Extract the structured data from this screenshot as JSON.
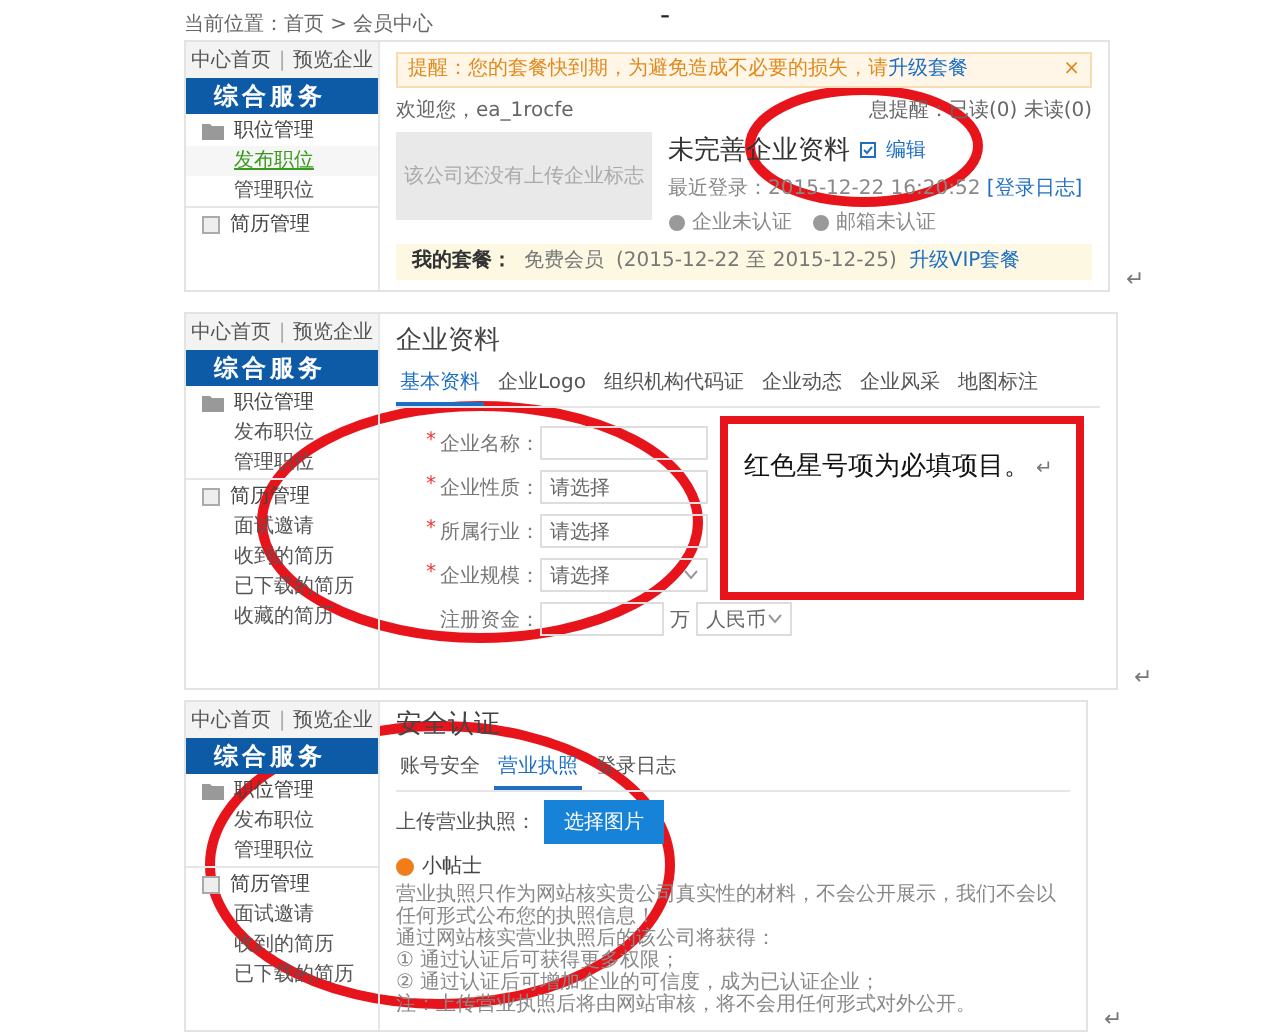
{
  "page_mark": "-",
  "member_center": {
    "breadcrumb": "当前位置：首页 > 会员中心",
    "sidebar": {
      "links": [
        "中心首页",
        "预览企业"
      ],
      "link_separator": "|",
      "header": "综合服务",
      "groups": [
        {
          "title": "职位管理",
          "items": [
            {
              "label": "发布职位",
              "selected": true
            },
            {
              "label": "管理职位",
              "selected": false
            }
          ]
        },
        {
          "title": "简历管理"
        }
      ]
    },
    "notice": {
      "text": "提醒：您的套餐快到期，为避免造成不必要的损失，请",
      "link": "升级套餐",
      "close": "×"
    },
    "welcome": "欢迎您，ea_1rocfe",
    "message_status": "息提醒：已读(0) 未读(0)",
    "logo_placeholder": "该公司还没有上传企业标志",
    "profile_status": "未完善企业资料",
    "edit_link": "编辑",
    "last_login": "最近登录：2015-12-22 16:20:52",
    "login_log_link": "[登录日志]",
    "badges": [
      "企业未认证",
      "邮箱未认证"
    ],
    "plan": {
      "label": "我的套餐：",
      "value": "免费会员",
      "period": "(2015-12-22 至 2015-12-25)",
      "upgrade_link": "升级VIP套餐"
    },
    "paragraph_mark": "↵"
  },
  "company_profile": {
    "sidebar": {
      "links": [
        "中心首页",
        "预览企业"
      ],
      "link_separator": "|",
      "header": "综合服务",
      "groups": [
        {
          "title": "职位管理",
          "items": [
            {
              "label": "发布职位",
              "selected": false
            },
            {
              "label": "管理职位",
              "selected": false
            }
          ]
        },
        {
          "title": "简历管理",
          "items": [
            {
              "label": "面试邀请",
              "selected": false
            },
            {
              "label": "收到的简历",
              "selected": false
            },
            {
              "label": "已下载的简历",
              "selected": false
            },
            {
              "label": "收藏的简历",
              "selected": false
            }
          ]
        }
      ]
    },
    "title": "企业资料",
    "tabs": [
      {
        "label": "基本资料",
        "selected": true
      },
      {
        "label": "企业Logo",
        "selected": false
      },
      {
        "label": "组织机构代码证",
        "selected": false
      },
      {
        "label": "企业动态",
        "selected": false
      },
      {
        "label": "企业风采",
        "selected": false
      },
      {
        "label": "地图标注",
        "selected": false
      }
    ],
    "fields": [
      {
        "kind": "text",
        "required_mark": "*",
        "label": "企业名称："
      },
      {
        "kind": "select_plain",
        "required_mark": "*",
        "label": "企业性质：",
        "placeholder": "请选择"
      },
      {
        "kind": "select_plain",
        "required_mark": "*",
        "label": "所属行业：",
        "placeholder": "请选择"
      },
      {
        "kind": "select",
        "required_mark": "*",
        "label": "企业规模：",
        "placeholder": "请选择"
      },
      {
        "kind": "money",
        "label": "注册资金：",
        "unit": "万",
        "currency": "人民币"
      }
    ],
    "paragraph_mark": "↵"
  },
  "note": {
    "text": "红色星号项为必填项目。",
    "paragraph_mark": "↵"
  },
  "security_auth": {
    "sidebar": {
      "links": [
        "中心首页",
        "预览企业"
      ],
      "link_separator": "|",
      "header": "综合服务",
      "groups": [
        {
          "title": "职位管理",
          "items": [
            {
              "label": "发布职位",
              "selected": false
            },
            {
              "label": "管理职位",
              "selected": false
            }
          ]
        },
        {
          "title": "简历管理",
          "items": [
            {
              "label": "面试邀请",
              "selected": false
            },
            {
              "label": "收到的简历",
              "selected": false
            },
            {
              "label": "已下载的简历",
              "selected": false
            }
          ]
        }
      ]
    },
    "title": "安全认证",
    "tabs": [
      {
        "label": "账号安全",
        "selected": false
      },
      {
        "label": "营业执照",
        "selected": true
      },
      {
        "label": "登录日志",
        "selected": false
      }
    ],
    "upload_label": "上传营业执照：",
    "upload_button": "选择图片",
    "tip_title": "小帖士",
    "tips": [
      "营业执照只作为网站核实贵公司真实性的材料，不会公开展示，我们不会以任何形式公布您的执照信息！",
      "通过网站核实营业执照后的该公司将获得：",
      "① 通过认证后可获得更多权限；",
      "② 通过认证后可增加企业的可信度，成为已认证企业；",
      "注：上传营业执照后将由网站审核，将不会用任何形式对外公开。"
    ],
    "paragraph_mark": "↵"
  }
}
